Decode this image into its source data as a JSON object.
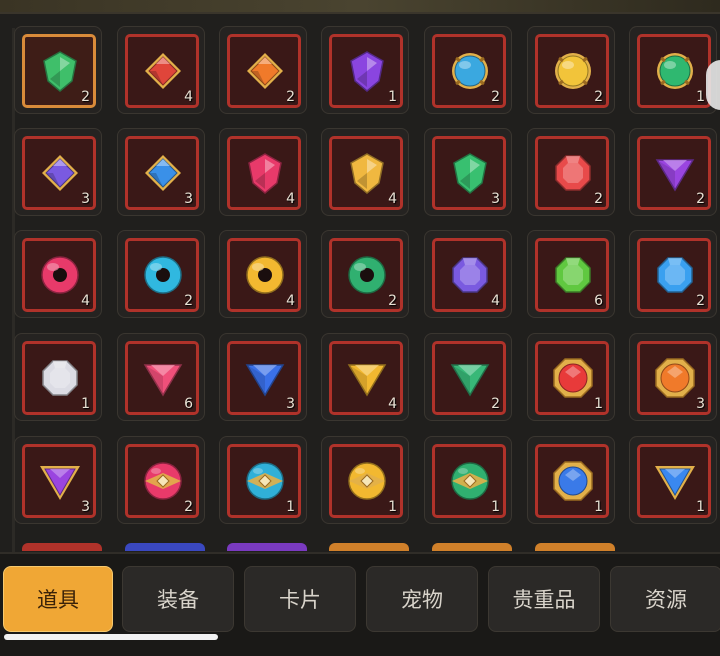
{
  "inventory": {
    "items": [
      {
        "gem": "shield",
        "color": "#3fbf6a",
        "count": "2"
      },
      {
        "gem": "diamond",
        "color": "#e0453a",
        "count": "4"
      },
      {
        "gem": "diamond",
        "color": "#f07a2a",
        "count": "2"
      },
      {
        "gem": "shield",
        "color": "#8a45e0",
        "count": "1"
      },
      {
        "gem": "orb",
        "color": "#3aa8e0",
        "count": "2"
      },
      {
        "gem": "orb",
        "color": "#f2c43a",
        "count": "2"
      },
      {
        "gem": "orb",
        "color": "#2fb870",
        "count": "1"
      },
      {
        "gem": "diamond",
        "color": "#7a5ae0",
        "count": "3"
      },
      {
        "gem": "diamond",
        "color": "#3a90e8",
        "count": "3"
      },
      {
        "gem": "shield",
        "color": "#e83a6a",
        "count": "4"
      },
      {
        "gem": "shield",
        "color": "#f0b840",
        "count": "4"
      },
      {
        "gem": "shield",
        "color": "#38c070",
        "count": "3"
      },
      {
        "gem": "octagon",
        "color": "#e84a4a",
        "count": "2"
      },
      {
        "gem": "triangle",
        "color": "#9a45e0",
        "count": "2"
      },
      {
        "gem": "ring",
        "color": "#e83a6a",
        "count": "4"
      },
      {
        "gem": "ring",
        "color": "#30b8e0",
        "count": "2"
      },
      {
        "gem": "ring",
        "color": "#f2b830",
        "count": "4"
      },
      {
        "gem": "ring",
        "color": "#30b070",
        "count": "2"
      },
      {
        "gem": "octagon",
        "color": "#7a5ae0",
        "count": "4"
      },
      {
        "gem": "octagon",
        "color": "#60c840",
        "count": "6"
      },
      {
        "gem": "octagon",
        "color": "#3aa0f0",
        "count": "2"
      },
      {
        "gem": "octagon",
        "color": "#dcdce4",
        "count": "1"
      },
      {
        "gem": "triangle",
        "color": "#f0507a",
        "count": "6"
      },
      {
        "gem": "triangle",
        "color": "#3a70e8",
        "count": "3"
      },
      {
        "gem": "triangle",
        "color": "#f2b830",
        "count": "4"
      },
      {
        "gem": "triangle",
        "color": "#38b878",
        "count": "2"
      },
      {
        "gem": "framed",
        "color": "#e83a3a",
        "count": "1"
      },
      {
        "gem": "framed",
        "color": "#f07a2a",
        "count": "3"
      },
      {
        "gem": "triangle-gold",
        "color": "#9a45e0",
        "count": "3"
      },
      {
        "gem": "round-gold",
        "color": "#e83a6a",
        "count": "2"
      },
      {
        "gem": "round-gold",
        "color": "#30b0d8",
        "count": "1"
      },
      {
        "gem": "round-gold",
        "color": "#f2b830",
        "count": "1"
      },
      {
        "gem": "round-gold",
        "color": "#30b070",
        "count": "1"
      },
      {
        "gem": "framed",
        "color": "#3a7ae8",
        "count": "1"
      },
      {
        "gem": "triangle-gold",
        "color": "#3a88f0",
        "count": "1"
      }
    ],
    "partial_row_colors": [
      "#b0322a",
      "#3a48c0",
      "#7a3ac0",
      "#d0802a",
      "#d0802a",
      "#d0802a"
    ]
  },
  "tabs": [
    {
      "label": "道具",
      "active": true
    },
    {
      "label": "装备",
      "active": false
    },
    {
      "label": "卡片",
      "active": false
    },
    {
      "label": "宠物",
      "active": false
    },
    {
      "label": "贵重品",
      "active": false
    },
    {
      "label": "资源",
      "active": false
    }
  ]
}
